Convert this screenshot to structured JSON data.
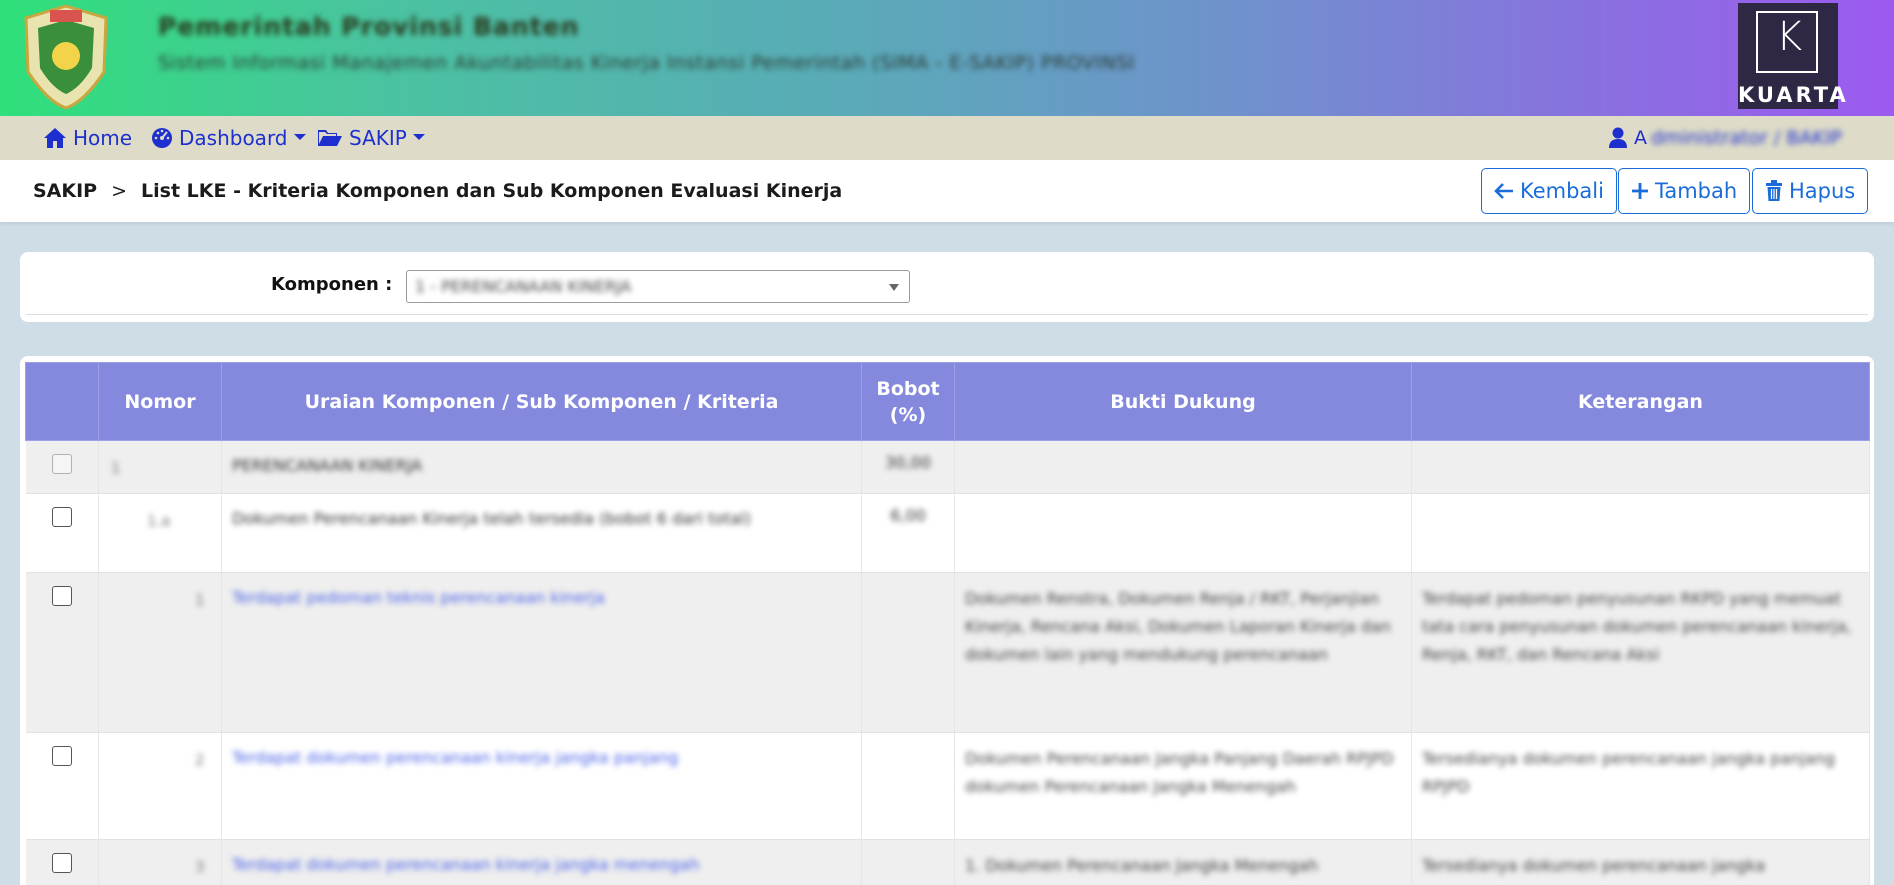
{
  "header": {
    "title": "Pemerintah Provinsi Banten",
    "subtitle": "Sistem Informasi Manajemen Akuntabilitas Kinerja Instansi Pemerintah (SIMA - E-SAKIP) PROVINSI",
    "brand_right": "KUARTA"
  },
  "nav": {
    "home": "Home",
    "dashboard": "Dashboard",
    "sakip": "SAKIP",
    "user_initial": "A",
    "user_rest": "dministrator / BAKIP"
  },
  "breadcrumb": {
    "root": "SAKIP",
    "separator": ">",
    "current": "List LKE - Kriteria Komponen dan Sub Komponen Evaluasi Kinerja"
  },
  "actions": {
    "back": "Kembali",
    "add": "Tambah",
    "delete": "Hapus"
  },
  "filter": {
    "label": "Komponen :",
    "selected": "1 - PERENCANAAN KINERJA"
  },
  "table": {
    "headers": {
      "nomor": "Nomor",
      "uraian": "Uraian Komponen / Sub Komponen / Kriteria",
      "bobot_line1": "Bobot",
      "bobot_line2": "(%)",
      "bukti": "Bukti Dukung",
      "ket": "Keterangan"
    },
    "rows": [
      {
        "nomor": "1",
        "uraian": "PERENCANAAN KINERJA",
        "bobot": "30,00",
        "bukti": "",
        "ket": ""
      },
      {
        "nomor": "1.a",
        "uraian": "Dokumen Perencanaan Kinerja telah tersedia (bobot 6 dari total)",
        "bobot": "6,00",
        "bukti": "",
        "ket": ""
      },
      {
        "nomor": "1",
        "uraian": "Terdapat pedoman teknis perencanaan kinerja",
        "bobot": "",
        "bukti": "Dokumen Renstra, Dokumen Renja / RKT, Perjanjian Kinerja, Rencana Aksi, Dokumen Laporan Kinerja dan dokumen lain yang mendukung perencanaan",
        "ket": "Terdapat pedoman penyusunan RKPD yang memuat tata cara penyusunan dokumen perencanaan kinerja, Renja, RKT, dan Rencana Aksi"
      },
      {
        "nomor": "2",
        "uraian": "Terdapat dokumen perencanaan kinerja jangka panjang",
        "bobot": "",
        "bukti": "Dokumen Perencanaan Jangka Panjang Daerah RPJPD dokumen Perencanaan Jangka Menengah",
        "ket": "Tersedianya dokumen perencanaan jangka panjang RPJPD"
      },
      {
        "nomor": "3",
        "uraian": "Terdapat dokumen perencanaan kinerja jangka menengah",
        "bobot": "",
        "bukti": "1. Dokumen Perencanaan Jangka Menengah",
        "ket": "Tersedianya dokumen perencanaan jangka"
      }
    ]
  },
  "colors": {
    "table_header": "#8589dd",
    "link": "#1e2fd0",
    "button": "#1a6dd9",
    "navbar": "#dedcc8"
  }
}
